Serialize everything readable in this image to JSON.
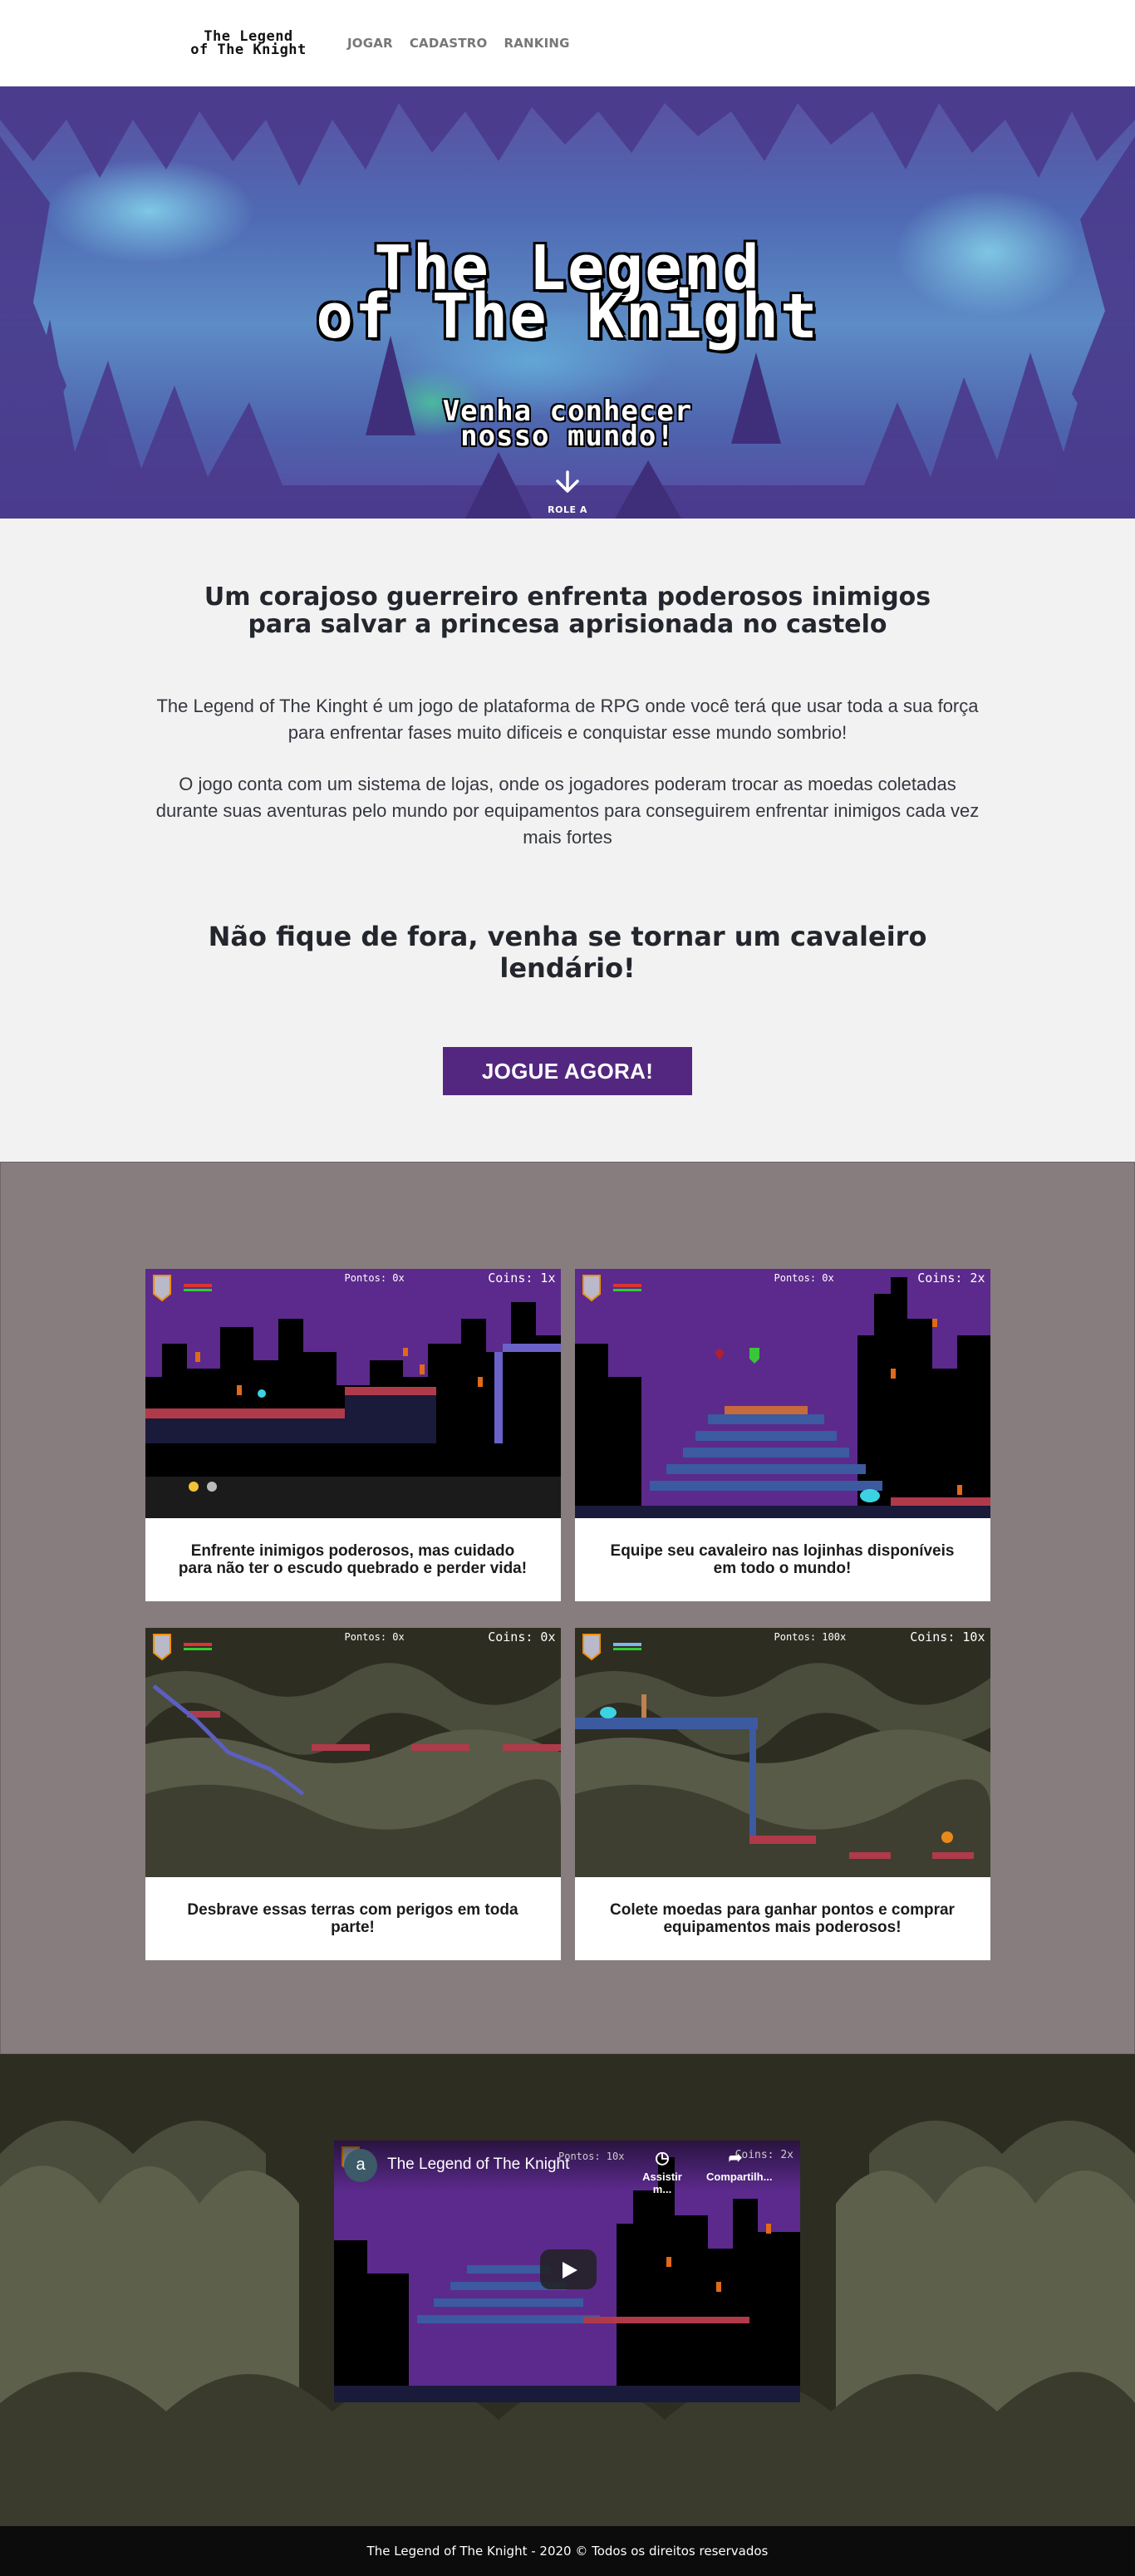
{
  "nav": {
    "brand_line1": "The Legend",
    "brand_line2": "of The Knight",
    "links": [
      {
        "label": "JOGAR"
      },
      {
        "label": "CADASTRO"
      },
      {
        "label": "RANKING"
      }
    ]
  },
  "hero": {
    "title_line1": "The Legend",
    "title_line2": "of The Knight",
    "subtitle_line1": "Venha conhecer",
    "subtitle_line2": "nosso mundo!",
    "scroll_label": "ROLE A",
    "scroll_icon": "arrow-down-icon"
  },
  "intro": {
    "headline": "Um corajoso guerreiro enfrenta poderosos inimigos para salvar a princesa aprisionada no castelo",
    "paragraph1": "The Legend of The Kinght é um jogo de plataforma de RPG onde você terá que usar toda a sua força para enfrentar fases muito dificeis e conquistar esse mundo sombrio!",
    "paragraph2": "O jogo conta com um sistema de lojas, onde os jogadores poderam trocar as moedas coletadas durante suas aventuras pelo mundo por equipamentos para conseguirem enfrentar inimigos cada vez mais fortes",
    "call_headline": "Não fique de fora, venha se tornar um cavaleiro lendário!",
    "cta_label": "JOGUE AGORA!"
  },
  "gallery": {
    "cards": [
      {
        "points": "Pontos: 0x",
        "coins": "Coins: 1x",
        "caption": "Enfrente inimigos poderosos, mas cuidado para não ter o escudo quebrado e perder vida!"
      },
      {
        "points": "Pontos: 0x",
        "coins": "Coins: 2x",
        "caption": "Equipe seu cavaleiro nas lojinhas disponíveis em todo o mundo!"
      },
      {
        "points": "Pontos: 0x",
        "coins": "Coins: 0x",
        "caption": "Desbrave essas terras com perigos em toda parte!"
      },
      {
        "points": "Pontos: 100x",
        "coins": "Coins: 10x",
        "caption": "Colete moedas para ganhar pontos e comprar equipamentos mais poderosos!"
      }
    ]
  },
  "video": {
    "avatar_letter": "a",
    "title": "The Legend of The Knight",
    "overlay_points": "Pontos: 10x",
    "overlay_coins": "Coins: 2x",
    "watch_later_label": "Assistir m...",
    "share_label": "Compartilh..."
  },
  "footer": {
    "text": "The Legend of The Knight - 2020 © Todos os direitos reservados"
  },
  "colors": {
    "cta_bg": "#532780",
    "gallery_bg": "#877d7e",
    "game_sky": "#5b2a8c",
    "footer_bg": "#0c0c0c"
  }
}
